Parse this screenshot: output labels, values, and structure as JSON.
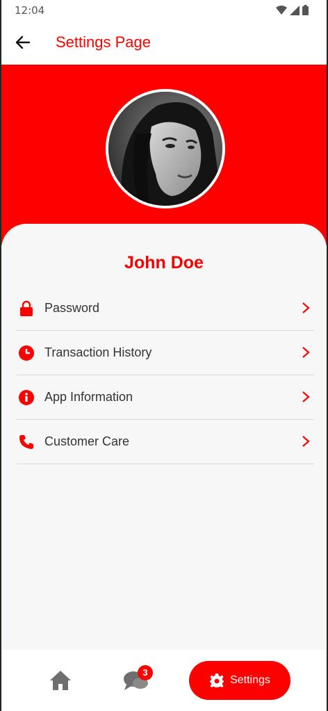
{
  "status_bar": {
    "time": "12:04"
  },
  "app_bar": {
    "title": "Settings Page"
  },
  "profile": {
    "name": "John Doe"
  },
  "menu": {
    "items": [
      {
        "label": "Password",
        "icon": "lock-icon"
      },
      {
        "label": "Transaction History",
        "icon": "clock-icon"
      },
      {
        "label": "App Information",
        "icon": "info-icon"
      },
      {
        "label": "Customer Care",
        "icon": "phone-icon"
      }
    ]
  },
  "bottom_nav": {
    "chat_badge": "3",
    "settings_label": "Settings"
  },
  "colors": {
    "accent": "#ff0000",
    "text": "#333333",
    "background": "#f7f7f7"
  }
}
